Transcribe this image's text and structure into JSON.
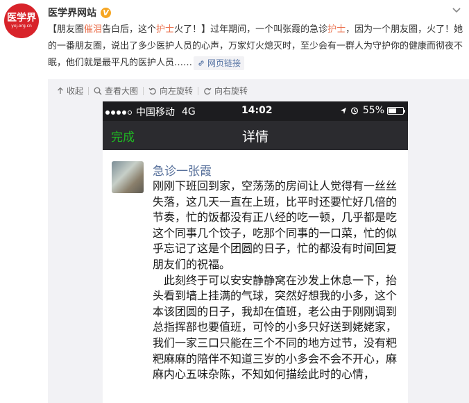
{
  "header": {
    "logo_main": "医学界",
    "logo_sub": "yxj.org.cn",
    "username": "医学界网站",
    "verified_badge": "V"
  },
  "post": {
    "part1": "【朋友圈",
    "hl1": "催泪",
    "part2": "告白后，这个",
    "hl2": "护士",
    "part3": "火了！】过年期间，一个叫张霞的急诊",
    "hl3": "护士",
    "part4": "，因为一个朋友圈，火了！她的一番朋友圈，说出了多少医护人员的心声，万家灯火熄灭时，至少会有一群人为守护你的健康而彻夜不眠，他们就是最平凡的医护人员……",
    "weblink_label": "网页链接"
  },
  "toolbar": {
    "collapse": "收起",
    "view_large": "查看大图",
    "rotate_left": "向左旋转",
    "rotate_right": "向右旋转"
  },
  "phone": {
    "carrier": "中国移动",
    "network": "4G",
    "time": "14:02",
    "battery": "55%",
    "done_label": "完成",
    "title": "详情",
    "sender": "急诊一张霞",
    "paragraph1": "刚刚下班回到家，空荡荡的房间让人觉得有一丝丝失落，这几天一直在上班，比平时还要忙好几倍的节奏，忙的饭都没有正八经的吃一顿，几乎都是吃这个同事几个饺子，吃那个同事的一口菜，忙的似乎忘记了这是个团圆的日子，忙的都没有时间回复朋友们的祝福。",
    "paragraph2": "此刻终于可以安安静静窝在沙发上休息一下，抬头看到墙上挂满的气球，突然好想我的小多，这个本该团圆的日子，我却在值班，老公由于刚刚调到总指挥部也要值班，可怜的小多只好送到姥姥家，我们一家三口只能在三个不同的地方过节，没有粑粑麻麻的陪伴不知道三岁的小多会不会不开心，麻麻内心五味杂陈，不知如何描绘此时的心情，"
  }
}
